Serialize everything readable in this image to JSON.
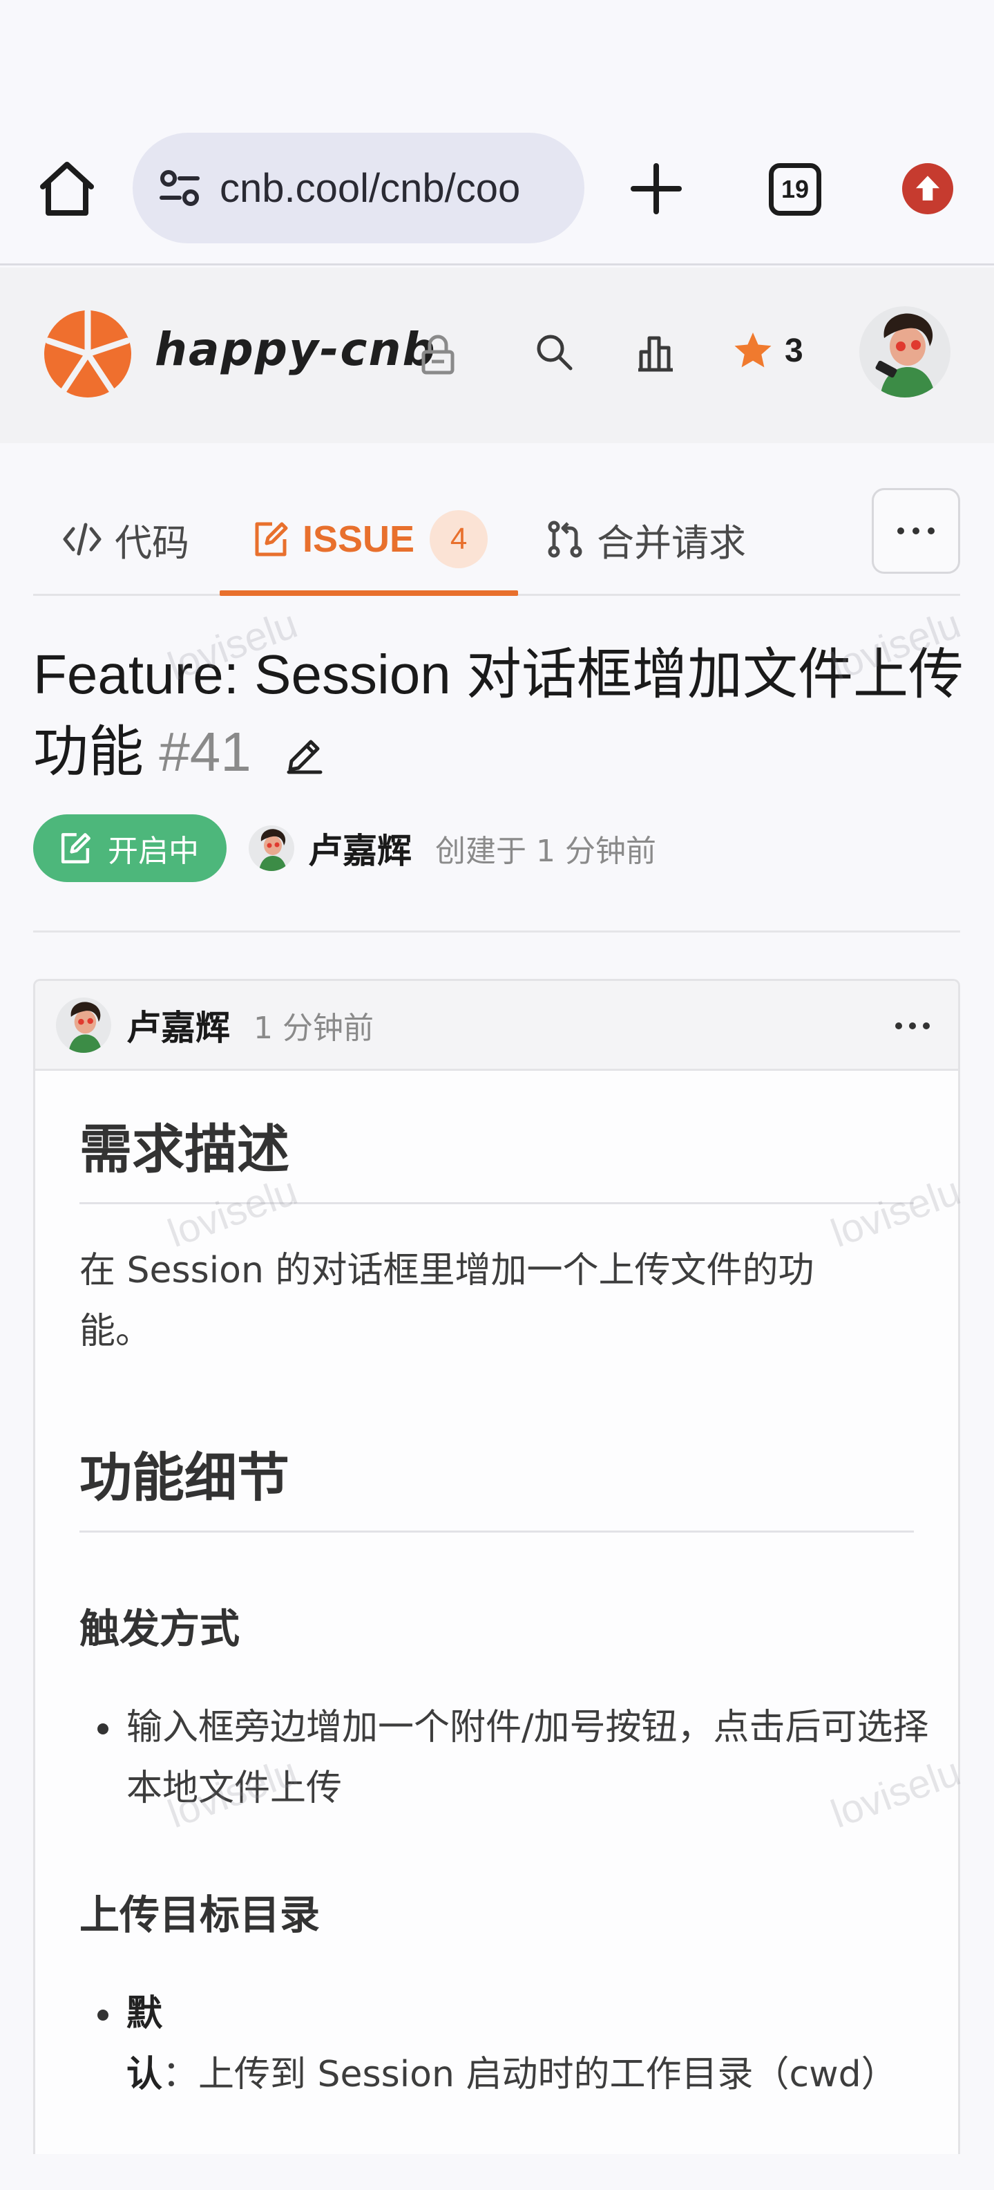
{
  "browser": {
    "url": "cnb.cool/cnb/coo",
    "tab_count": "19"
  },
  "repo": {
    "name": "happy-cnb",
    "star_count": "3"
  },
  "tabs": [
    {
      "label": "代码"
    },
    {
      "label": "ISSUE",
      "badge": "4"
    },
    {
      "label": "合并请求"
    }
  ],
  "issue": {
    "title": "Feature: Session 对话框增加文件上传功能",
    "number": "#41",
    "status": "开启中",
    "author": "卢嘉辉",
    "created": "创建于 1 分钟前"
  },
  "comment": {
    "author": "卢嘉辉",
    "time": "1 分钟前",
    "h_requirement": "需求描述",
    "p_requirement": "在 Session 的对话框里增加一个上传文件的功能。",
    "h_details": "功能细节",
    "h_trigger": "触发方式",
    "trigger_items": [
      "输入框旁边增加一个附件/加号按钮，点击后可选择本地文件上传"
    ],
    "h_target": "上传目标目录",
    "target_items": [
      {
        "bold": "默认",
        "text": "：上传到 Session 启动时的工作目录（cwd）"
      }
    ]
  },
  "watermark": "loviselu",
  "colors": {
    "accent": "#e8702d",
    "status_open": "#4db77b",
    "star": "#f07a2e"
  }
}
